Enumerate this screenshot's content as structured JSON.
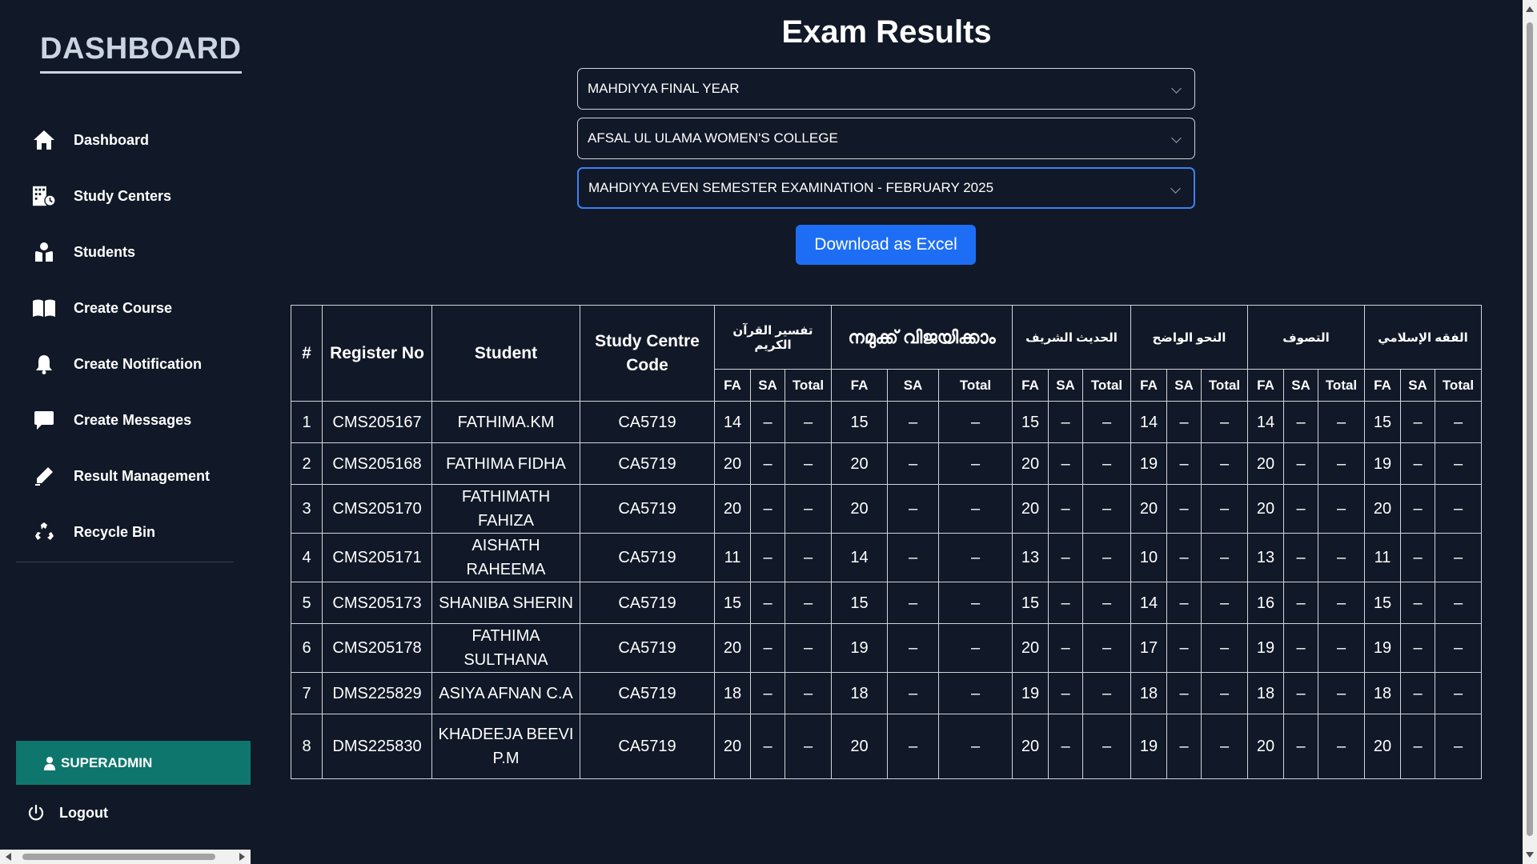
{
  "sidebar": {
    "brand": "DASHBOARD",
    "items": [
      {
        "label": "Dashboard",
        "icon": "home-icon"
      },
      {
        "label": "Study Centers",
        "icon": "building-icon"
      },
      {
        "label": "Students",
        "icon": "students-icon"
      },
      {
        "label": "Create Course",
        "icon": "book-icon"
      },
      {
        "label": "Create Notification",
        "icon": "bell-icon"
      },
      {
        "label": "Create Messages",
        "icon": "message-icon"
      },
      {
        "label": "Result Management",
        "icon": "pen-icon"
      },
      {
        "label": "Recycle Bin",
        "icon": "recycle-icon"
      }
    ],
    "user_role": "SUPERADMIN",
    "logout": "Logout"
  },
  "main": {
    "title": "Exam Results",
    "selects": {
      "course": "MAHDIYYA FINAL YEAR",
      "college": "AFSAL UL ULAMA WOMEN'S COLLEGE",
      "exam": "MAHDIYYA EVEN SEMESTER EXAMINATION - FEBRUARY 2025"
    },
    "download_button": "Download as Excel"
  },
  "colors": {
    "background": "#111827",
    "accent_blue": "#1d6ef5",
    "superadmin_teal": "#0f766e",
    "border": "#d1d5db"
  },
  "table": {
    "headers": {
      "index": "#",
      "register_no": "Register No",
      "student": "Student",
      "study_centre_code": "Study Centre Code"
    },
    "subjects": [
      "تفسير القرآن الكريم",
      "നമുക്ക് വിജയിക്കാം",
      "الحديث الشريف",
      "النحو الواضح",
      "التصوف",
      "الفقه الإسلامي"
    ],
    "subheaders": {
      "fa": "FA",
      "sa": "SA",
      "total": "Total"
    },
    "rows": [
      {
        "index": "1",
        "register_no": "CMS205167",
        "student": "FATHIMA.KM",
        "code": "CA5719",
        "fa": [
          "14",
          "15",
          "15",
          "14",
          "14",
          "15"
        ],
        "sa": [
          "–",
          "–",
          "–",
          "–",
          "–",
          "–"
        ],
        "total": [
          "–",
          "–",
          "–",
          "–",
          "–",
          "–"
        ]
      },
      {
        "index": "2",
        "register_no": "CMS205168",
        "student": "FATHIMA FIDHA",
        "code": "CA5719",
        "fa": [
          "20",
          "20",
          "20",
          "19",
          "20",
          "19"
        ],
        "sa": [
          "–",
          "–",
          "–",
          "–",
          "–",
          "–"
        ],
        "total": [
          "–",
          "–",
          "–",
          "–",
          "–",
          "–"
        ]
      },
      {
        "index": "3",
        "register_no": "CMS205170",
        "student": "FATHIMATH FAHIZA",
        "code": "CA5719",
        "fa": [
          "20",
          "20",
          "20",
          "20",
          "20",
          "20"
        ],
        "sa": [
          "–",
          "–",
          "–",
          "–",
          "–",
          "–"
        ],
        "total": [
          "–",
          "–",
          "–",
          "–",
          "–",
          "–"
        ]
      },
      {
        "index": "4",
        "register_no": "CMS205171",
        "student": "AISHATH RAHEEMA",
        "code": "CA5719",
        "fa": [
          "11",
          "14",
          "13",
          "10",
          "13",
          "11"
        ],
        "sa": [
          "–",
          "–",
          "–",
          "–",
          "–",
          "–"
        ],
        "total": [
          "–",
          "–",
          "–",
          "–",
          "–",
          "–"
        ]
      },
      {
        "index": "5",
        "register_no": "CMS205173",
        "student": "SHANIBA SHERIN",
        "code": "CA5719",
        "fa": [
          "15",
          "15",
          "15",
          "14",
          "16",
          "15"
        ],
        "sa": [
          "–",
          "–",
          "–",
          "–",
          "–",
          "–"
        ],
        "total": [
          "–",
          "–",
          "–",
          "–",
          "–",
          "–"
        ]
      },
      {
        "index": "6",
        "register_no": "CMS205178",
        "student": "FATHIMA SULTHANA",
        "code": "CA5719",
        "fa": [
          "20",
          "19",
          "20",
          "17",
          "19",
          "19"
        ],
        "sa": [
          "–",
          "–",
          "–",
          "–",
          "–",
          "–"
        ],
        "total": [
          "–",
          "–",
          "–",
          "–",
          "–",
          "–"
        ]
      },
      {
        "index": "7",
        "register_no": "DMS225829",
        "student": "ASIYA AFNAN C.A",
        "code": "CA5719",
        "fa": [
          "18",
          "18",
          "19",
          "18",
          "18",
          "18"
        ],
        "sa": [
          "–",
          "–",
          "–",
          "–",
          "–",
          "–"
        ],
        "total": [
          "–",
          "–",
          "–",
          "–",
          "–",
          "–"
        ]
      },
      {
        "index": "8",
        "register_no": "DMS225830",
        "student": "KHADEEJA BEEVI P.M",
        "code": "CA5719",
        "fa": [
          "20",
          "20",
          "20",
          "19",
          "20",
          "20"
        ],
        "sa": [
          "–",
          "–",
          "–",
          "–",
          "–",
          "–"
        ],
        "total": [
          "–",
          "–",
          "–",
          "–",
          "–",
          "–"
        ]
      }
    ]
  }
}
